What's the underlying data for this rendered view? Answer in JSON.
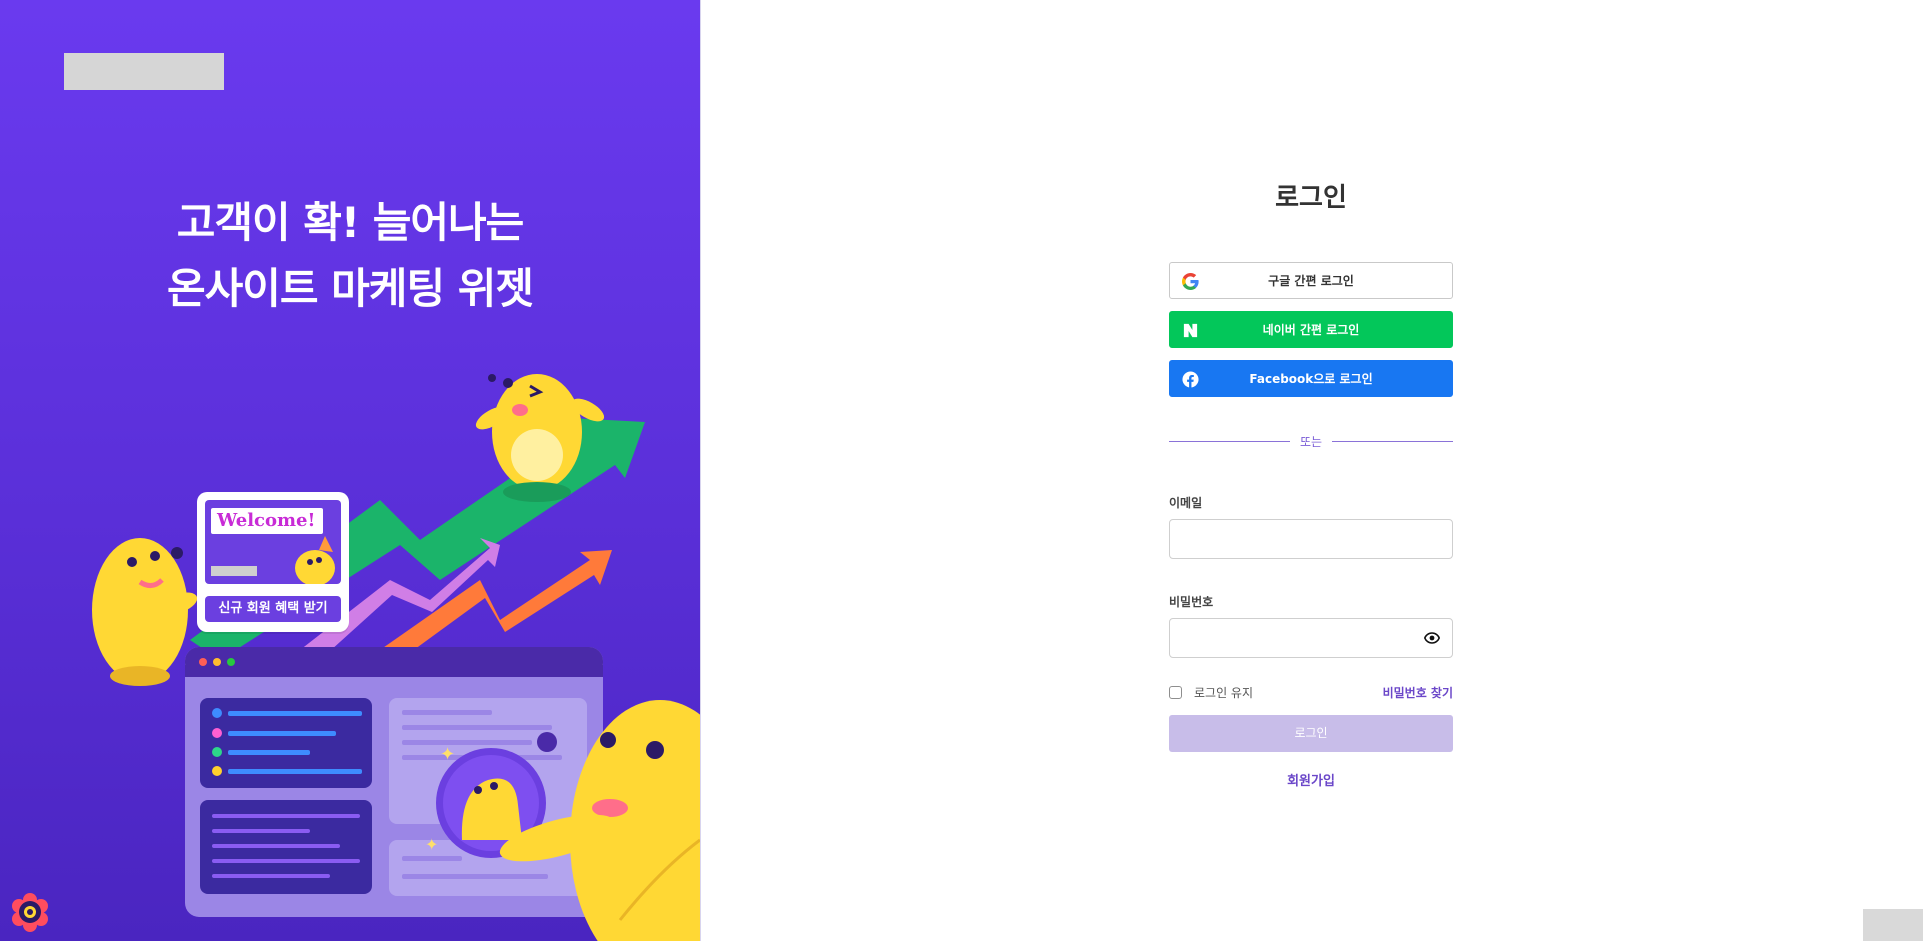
{
  "hero": {
    "title_line1": "고객이 확! 늘어나는",
    "title_line2": "온사이트 마케팅 위젯",
    "welcome_text": "Welcome!",
    "welcome_button": "신규 회원 혜택 받기",
    "background_color": "#6a3aef"
  },
  "login": {
    "title": "로그인",
    "google_label": "구글 간편 로그인",
    "naver_label": "네이버 간편 로그인",
    "facebook_label": "Facebook으로 로그인",
    "divider_text": "또는",
    "email_label": "이메일",
    "email_value": "",
    "password_label": "비밀번호",
    "password_value": "",
    "remember_label": "로그인 유지",
    "remember_checked": false,
    "find_password": "비밀번호 찾기",
    "submit_label": "로그인",
    "signup_label": "회원가입"
  },
  "icons": {
    "google": "google-icon",
    "naver": "naver-icon",
    "facebook": "facebook-icon",
    "eye": "eye-icon",
    "settings": "settings-icon"
  },
  "colors": {
    "accent": "#6b47c9",
    "naver": "#03c75a",
    "facebook": "#1877f2",
    "submit_disabled": "#c8bde9"
  }
}
